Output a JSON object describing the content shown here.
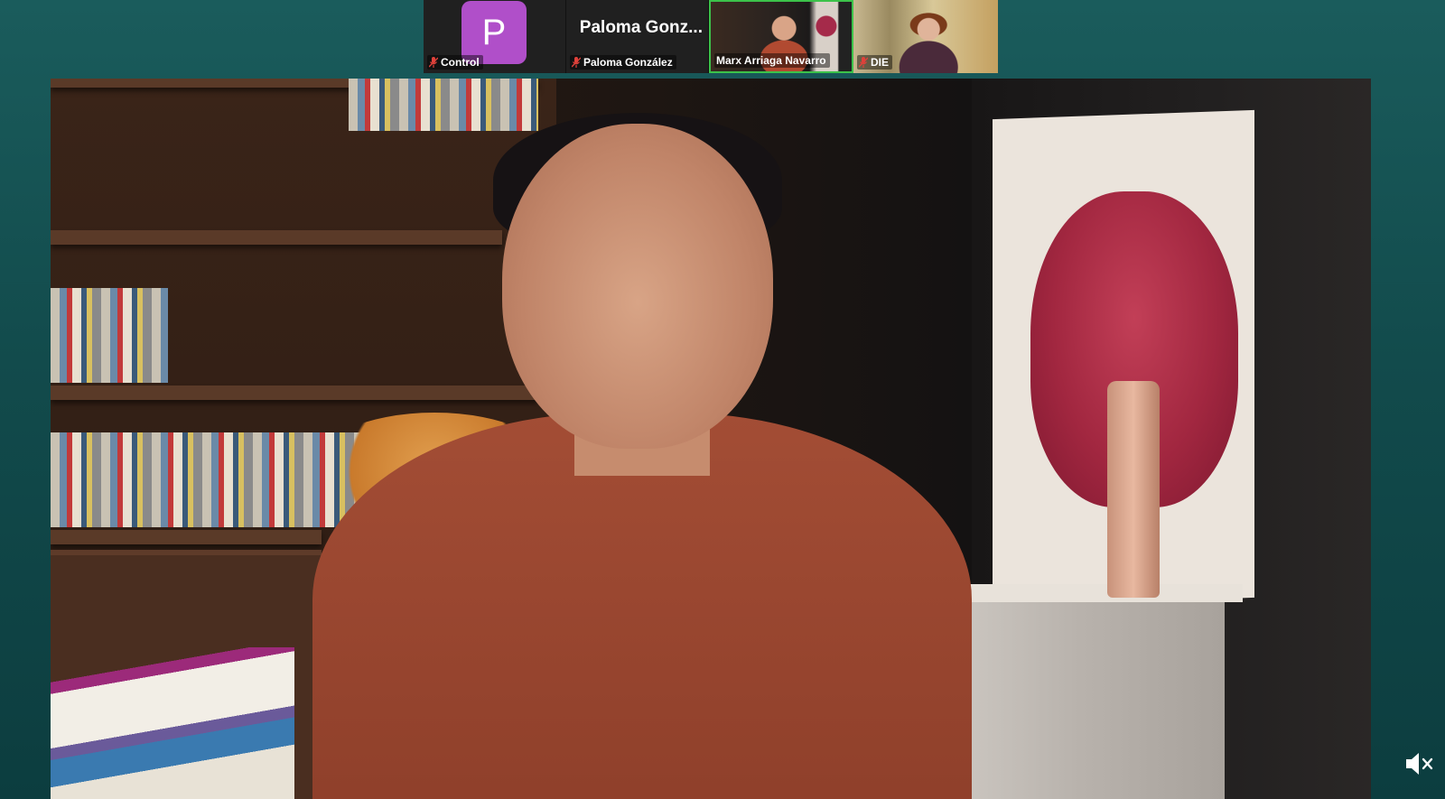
{
  "participants": [
    {
      "avatar_letter": "P",
      "display_name_short": "",
      "label": "Control",
      "avatar_color": "#b04fc9",
      "muted": true
    },
    {
      "avatar_letter": "",
      "display_name_short": "Paloma Gonz...",
      "label": "Paloma González",
      "muted": true
    },
    {
      "label": "Marx Arriaga Navarro",
      "active_speaker": true,
      "highlight_color": "#3cc24a",
      "muted": false
    },
    {
      "label": "DIE",
      "muted": true
    }
  ],
  "main_video": {
    "speaker": "Marx Arriaga Navarro"
  },
  "speaker_audio": {
    "icon": "speaker-muted-icon",
    "state": "muted"
  },
  "colors": {
    "background": "#124b4c",
    "muted_mic": "#e0413a"
  }
}
